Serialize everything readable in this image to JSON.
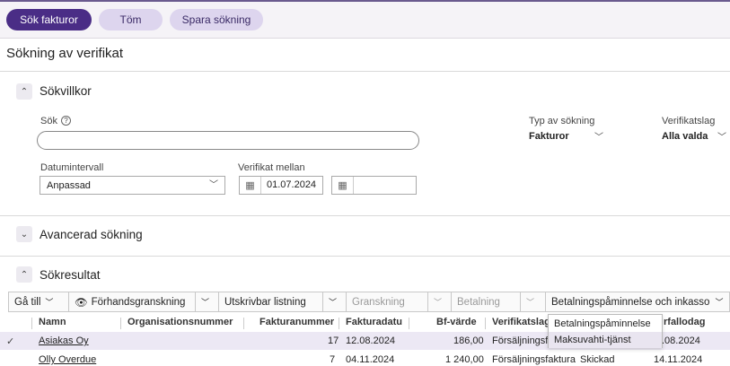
{
  "top_actions": {
    "search_btn": "Sök fakturor",
    "clear_btn": "Töm",
    "save_btn": "Spara sökning"
  },
  "page_title": "Sökning av verifikat",
  "criteria": {
    "title": "Sökvillkor",
    "search_label": "Sök",
    "help_symbol": "?",
    "search_value": "",
    "type_label": "Typ av sökning",
    "type_value": "Fakturor",
    "vtype_label": "Verifikatslag",
    "vtype_value": "Alla valda",
    "date_label": "Datumintervall",
    "date_value": "Anpassad",
    "between_label": "Verifikat mellan",
    "date_from": "01.07.2024",
    "date_to": ""
  },
  "advanced": {
    "title": "Avancerad sökning"
  },
  "results": {
    "title": "Sökresultat",
    "toolbar": {
      "add_to": "Gå till",
      "preview": "Förhandsgranskning",
      "printable": "Utskrivbar listning",
      "review": "Granskning",
      "payment": "Betalning",
      "reminder": "Betalningspåminnelse och inkasso"
    },
    "columns": [
      "Namn",
      "Organisationsnummer",
      "Fakturanummer",
      "Fakturadatu",
      "Bf-värde",
      "Verifikatslag",
      "Status",
      "rfallodag"
    ],
    "rows": [
      {
        "name": "Asiakas Oy",
        "org": "",
        "num": "17",
        "date": "12.08.2024",
        "value": "186,00",
        "type": "Försäljningsf",
        "status": "",
        "due": ".08.2024",
        "selected": true
      },
      {
        "name": "Olly Overdue",
        "org": "",
        "num": "7",
        "date": "04.11.2024",
        "value": "1 240,00",
        "type": "Försäljningsfaktura",
        "status": "Skickad",
        "due": "14.11.2024",
        "selected": false
      }
    ],
    "dropdown": [
      "Betalningspåminnelse",
      "Maksuvahti-tjänst"
    ]
  },
  "colors": {
    "brand": "#4a2d86",
    "brand_light": "#ddd5ee"
  }
}
